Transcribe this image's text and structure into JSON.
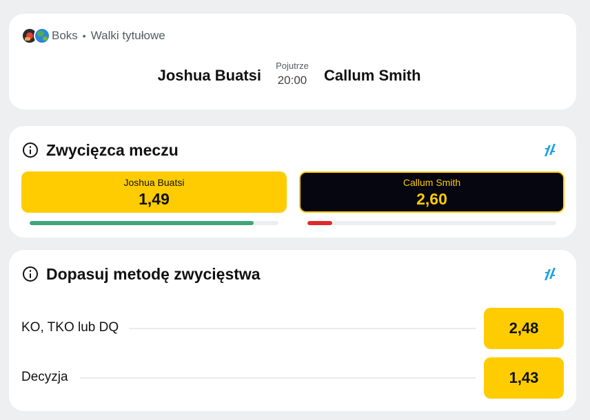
{
  "event": {
    "sport": "Boks",
    "separator": "•",
    "league": "Walki tytułowe",
    "icons": [
      "boxing-icon",
      "globe-icon"
    ],
    "home_team": "Joshua Buatsi",
    "away_team": "Callum Smith",
    "day": "Pojutrze",
    "time": "20:00"
  },
  "match_winner": {
    "title": "Zwycięzca meczu",
    "icons": [
      "info-icon",
      "stats-icon"
    ],
    "home": {
      "name": "Joshua Buatsi",
      "odd": "1,49",
      "probability": 0.9
    },
    "away": {
      "name": "Callum Smith",
      "odd": "2,60",
      "probability": 0.1
    }
  },
  "method": {
    "title": "Dopasuj metodę zwycięstwa",
    "icons": [
      "info-icon",
      "stats-icon"
    ],
    "rows": [
      {
        "label": "KO, TKO lub DQ",
        "odd": "2,48"
      },
      {
        "label": "Decyzja",
        "odd": "1,43"
      }
    ]
  },
  "colors": {
    "background": "#eeeff1",
    "card": "#ffffff",
    "accent_yellow": "#fecc00",
    "dark_button": "#05060f",
    "progress_green": "#3ea67b",
    "progress_red": "#e02a2a",
    "stats_icon_blue": "#1da1e8"
  }
}
